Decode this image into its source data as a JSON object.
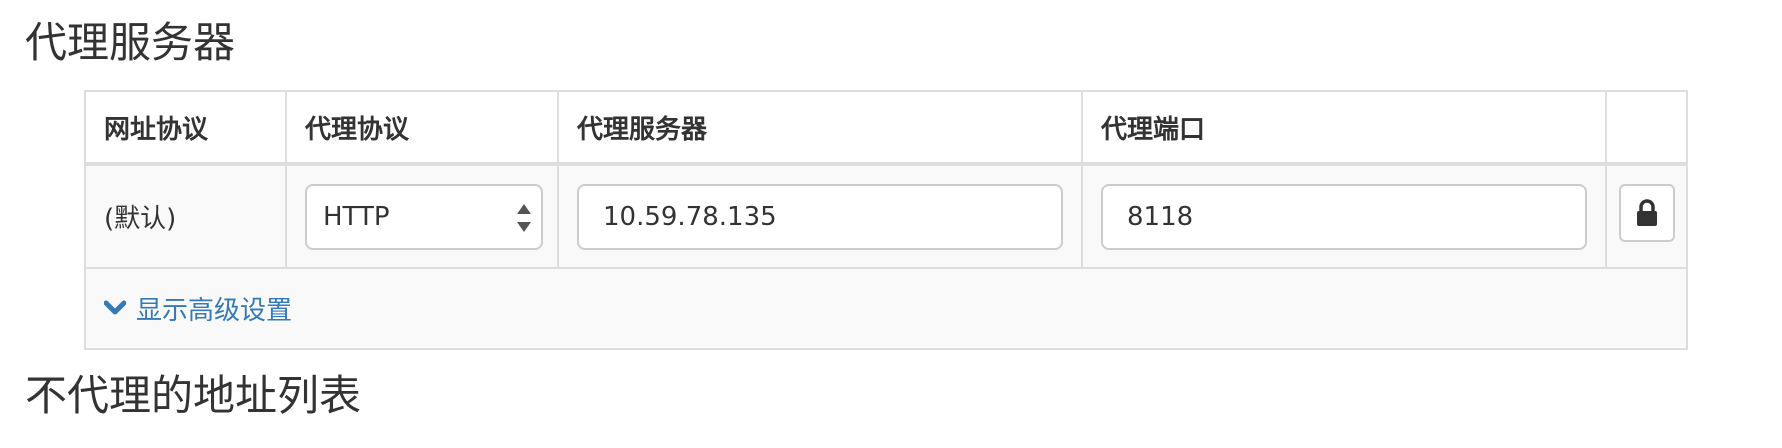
{
  "sections": {
    "proxy_title": "代理服务器",
    "bypass_title": "不代理的地址列表"
  },
  "table": {
    "headers": {
      "url_scheme": "网址协议",
      "proxy_scheme": "代理协议",
      "proxy_host": "代理服务器",
      "proxy_port": "代理端口"
    },
    "rows": [
      {
        "scheme": "(默认)",
        "protocol": "HTTP",
        "host": "10.59.78.135",
        "port": "8118",
        "lock_icon": "lock-icon"
      }
    ]
  },
  "advanced": {
    "icon": "chevron-down-icon",
    "label": "显示高级设置"
  },
  "colors": {
    "text": "#333333",
    "border": "#dddddd",
    "input_border": "#cccccc",
    "row_background": "#f9f9f9",
    "link": "#337ab7"
  }
}
